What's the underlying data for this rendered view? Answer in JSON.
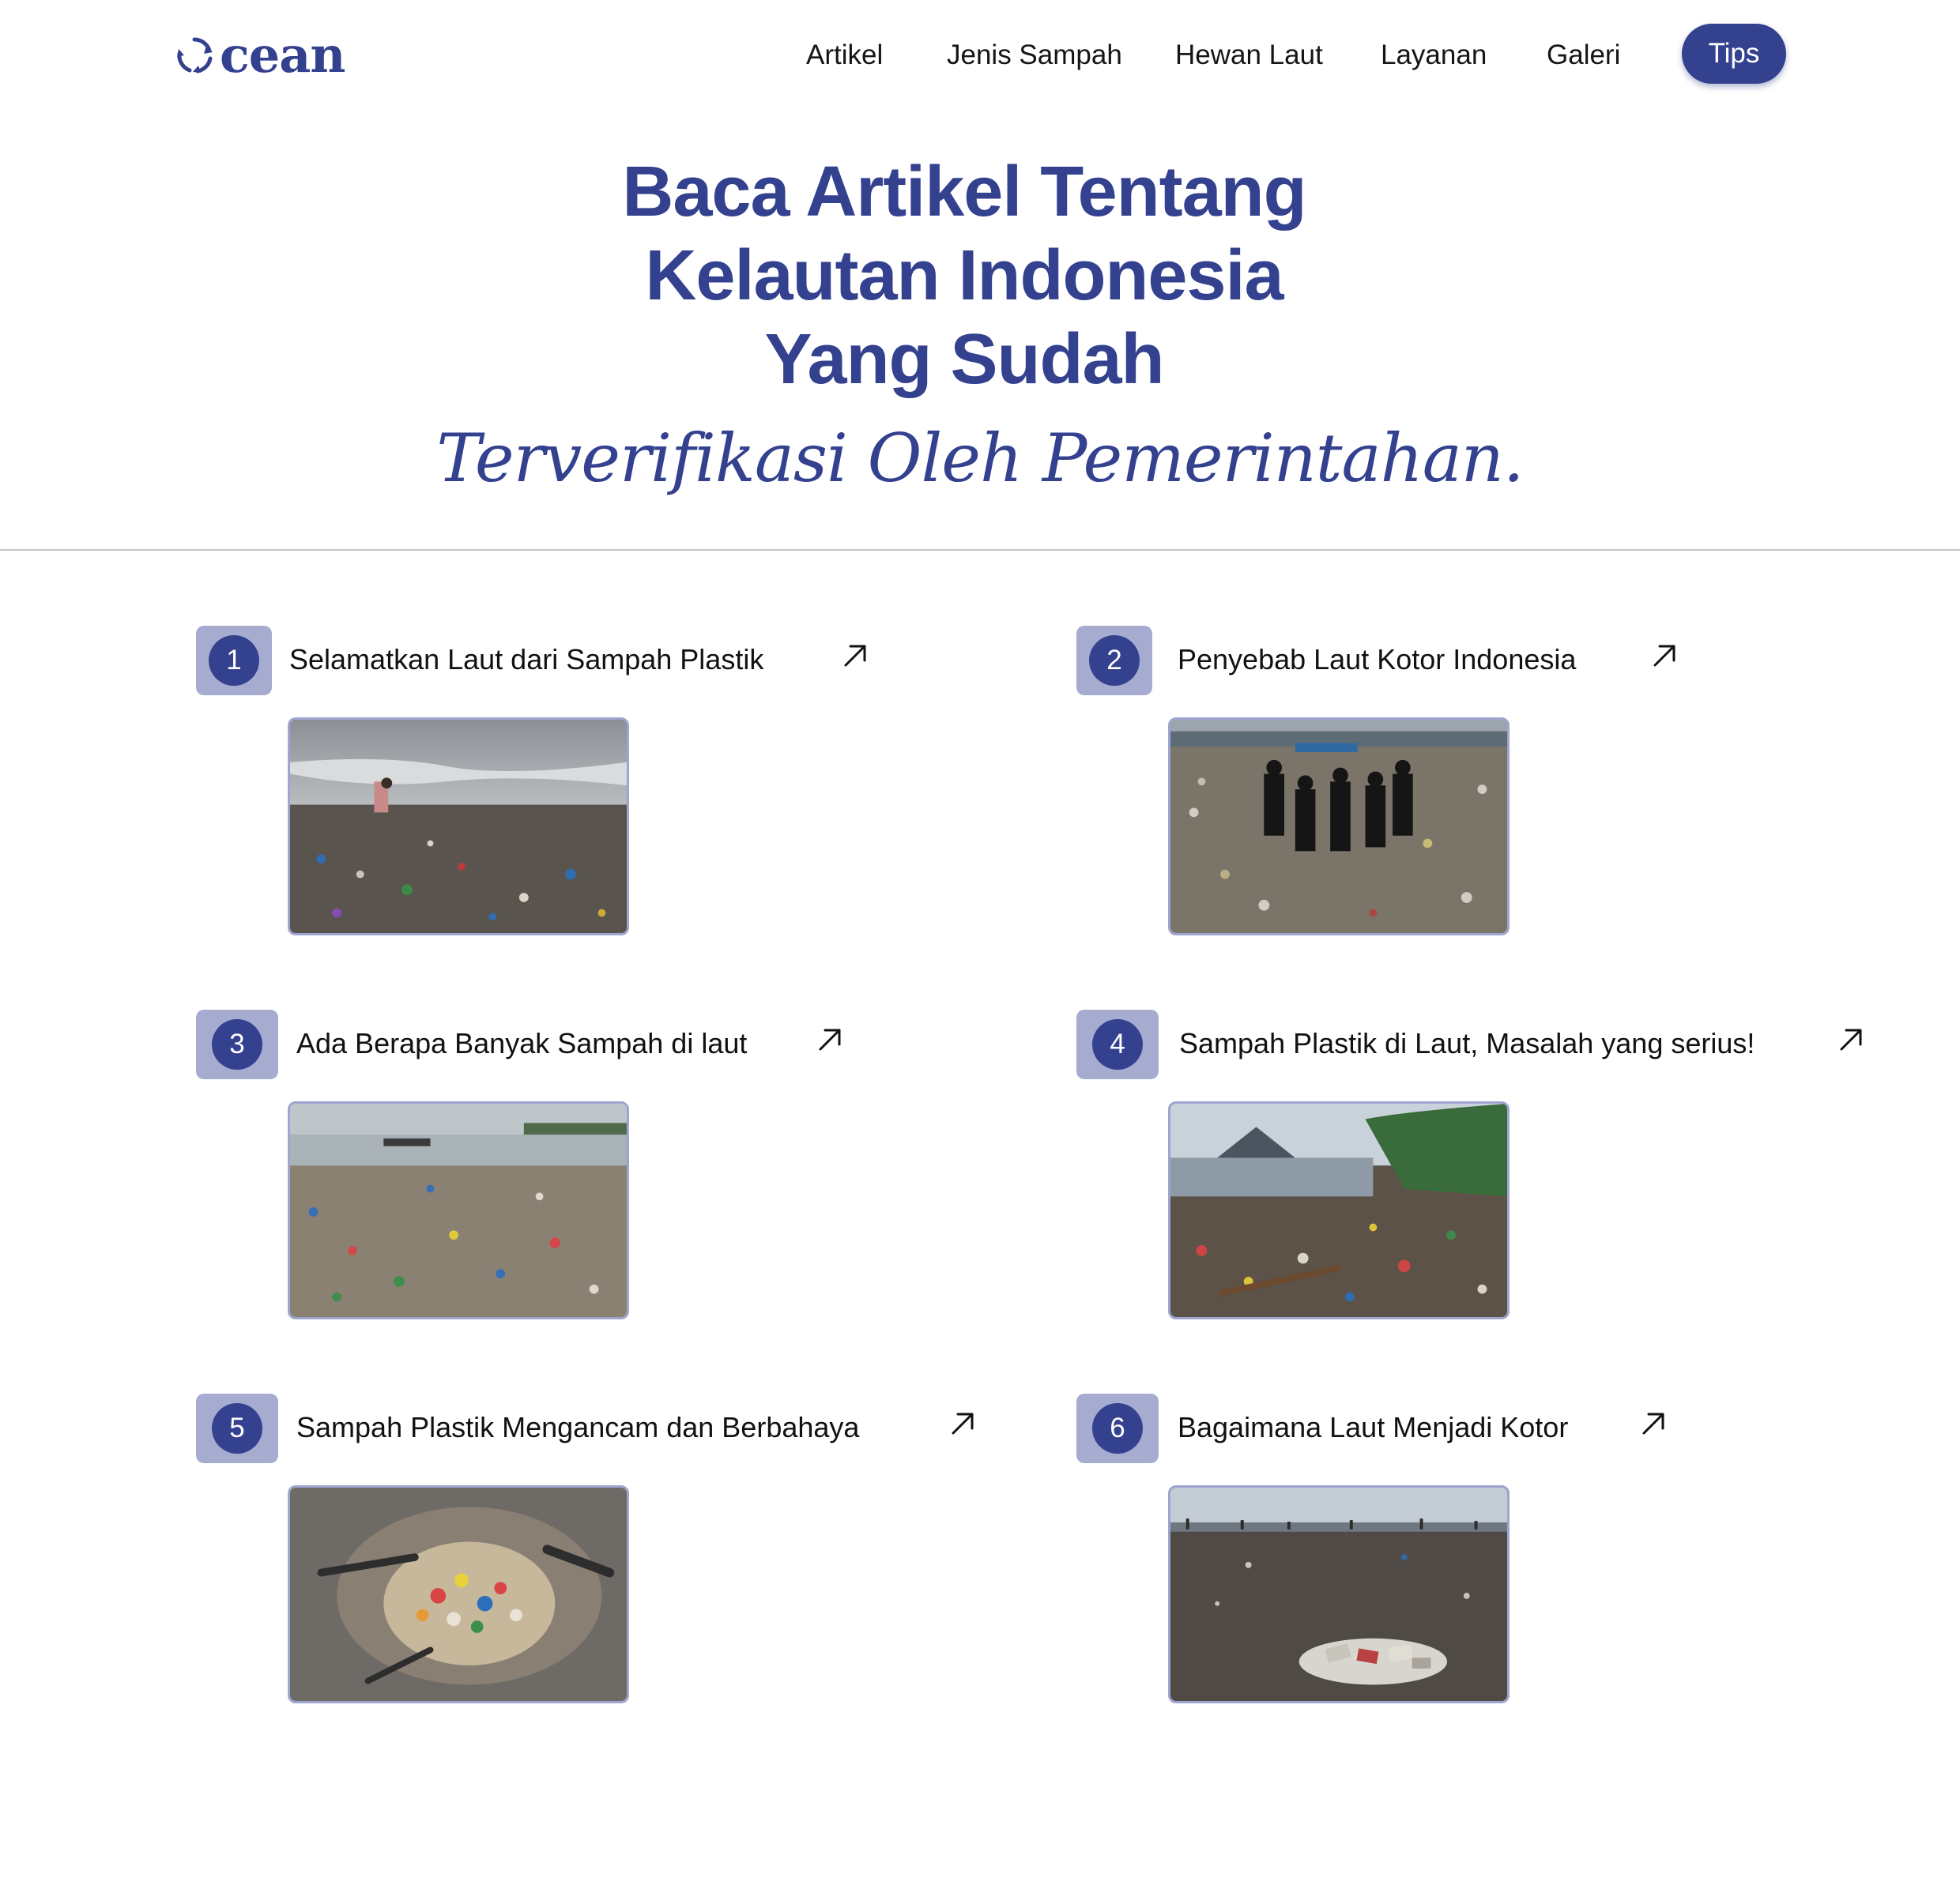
{
  "brand": {
    "name": "cean",
    "color": "#33418f"
  },
  "nav": {
    "links": [
      "Artikel",
      "Jenis Sampah",
      "Hewan Laut",
      "Layanan",
      "Galeri"
    ],
    "cta_label": "Tips"
  },
  "hero": {
    "title_lines": [
      "Baca Artikel Tentang",
      "Kelautan Indonesia",
      "Yang Sudah"
    ],
    "subtitle": "Terverifikasi Oleh Pemerintahan."
  },
  "articles": [
    {
      "number": "1",
      "title": "Selamatkan Laut dari Sampah Plastik"
    },
    {
      "number": "2",
      "title": "Penyebab Laut Kotor Indonesia"
    },
    {
      "number": "3",
      "title": "Ada Berapa Banyak Sampah di laut"
    },
    {
      "number": "4",
      "title": "Sampah Plastik di Laut, Masalah yang serius!"
    },
    {
      "number": "5",
      "title": "Sampah Plastik Mengancam dan Berbahaya"
    },
    {
      "number": "6",
      "title": "Bagaimana Laut Menjadi Kotor"
    }
  ],
  "colors": {
    "accent": "#33418f",
    "badge_bg": "#a6acd0",
    "divider": "#c8c8c8"
  }
}
